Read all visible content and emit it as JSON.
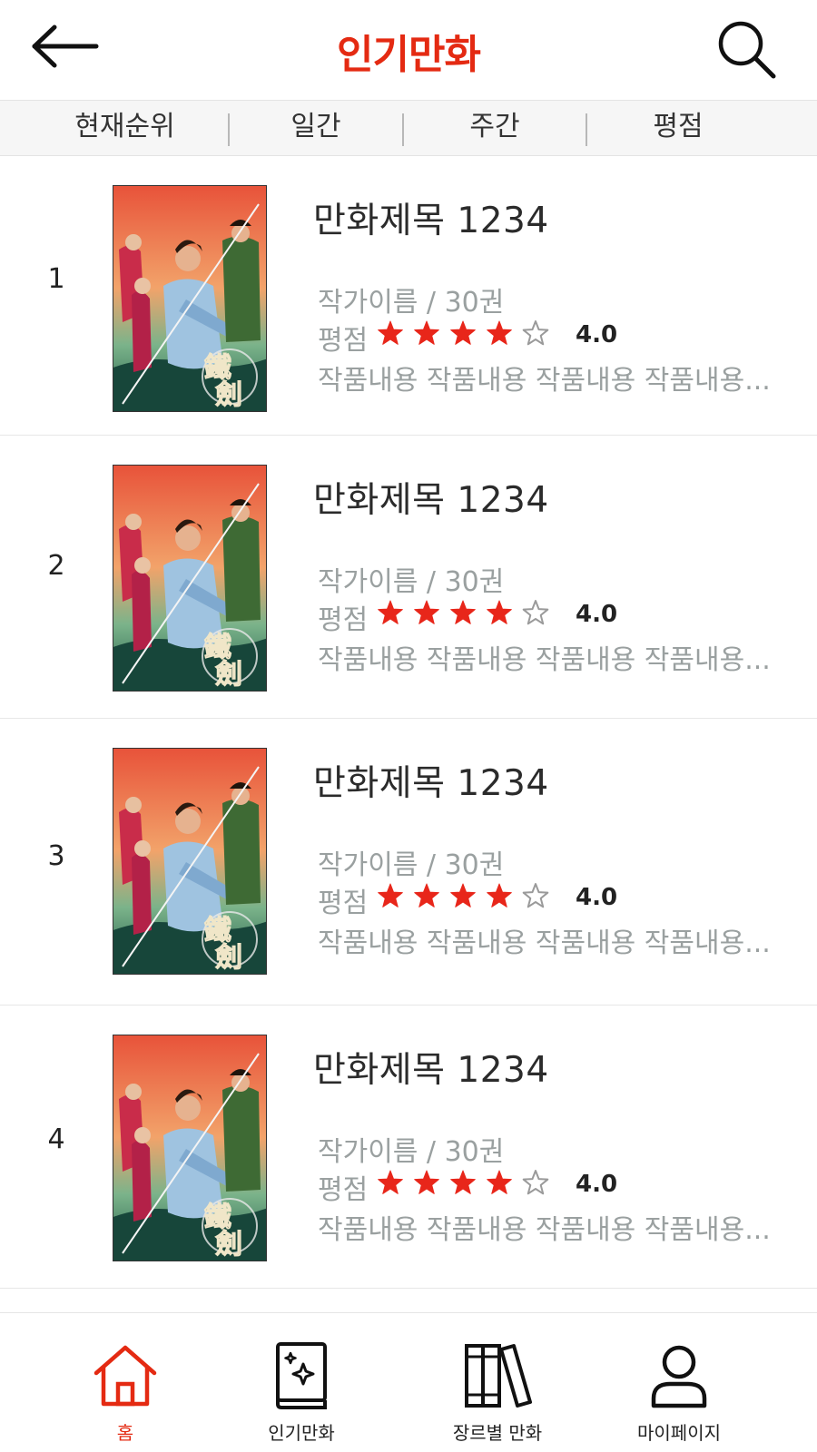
{
  "header": {
    "title": "인기만화",
    "back_icon": "back-arrow-icon",
    "search_icon": "search-icon"
  },
  "colors": {
    "accent": "#e42a12",
    "star": "#e8261a",
    "muted_text": "#9aa0a0",
    "tab_bg": "#f6f6f6"
  },
  "tabs": [
    {
      "label": "현재순위"
    },
    {
      "label": "일간"
    },
    {
      "label": "주간"
    },
    {
      "label": "평점"
    }
  ],
  "comics": [
    {
      "rank": "1",
      "title": "만화제목 1234",
      "author_volumes": "작가이름 / 30권",
      "rating_label": "평점",
      "rating": "4.0",
      "rating_stars": 4,
      "max_stars": 5,
      "description": "작품내용 작품내용 작품내용 작품내용...",
      "cover_text": "鐵劍"
    },
    {
      "rank": "2",
      "title": "만화제목 1234",
      "author_volumes": "작가이름 / 30권",
      "rating_label": "평점",
      "rating": "4.0",
      "rating_stars": 4,
      "max_stars": 5,
      "description": "작품내용 작품내용 작품내용 작품내용...",
      "cover_text": "鐵劍"
    },
    {
      "rank": "3",
      "title": "만화제목 1234",
      "author_volumes": "작가이름 / 30권",
      "rating_label": "평점",
      "rating": "4.0",
      "rating_stars": 4,
      "max_stars": 5,
      "description": "작품내용 작품내용 작품내용 작품내용...",
      "cover_text": "鐵劍"
    },
    {
      "rank": "4",
      "title": "만화제목 1234",
      "author_volumes": "작가이름 / 30권",
      "rating_label": "평점",
      "rating": "4.0",
      "rating_stars": 4,
      "max_stars": 5,
      "description": "작품내용 작품내용 작품내용 작품내용...",
      "cover_text": "鐵劍"
    }
  ],
  "bottom_nav": [
    {
      "label": "홈",
      "icon": "home-icon",
      "active": true
    },
    {
      "label": "인기만화",
      "icon": "sparkle-book-icon",
      "active": false
    },
    {
      "label": "장르별 만화",
      "icon": "bookshelf-icon",
      "active": false
    },
    {
      "label": "마이페이지",
      "icon": "user-icon",
      "active": false
    }
  ]
}
